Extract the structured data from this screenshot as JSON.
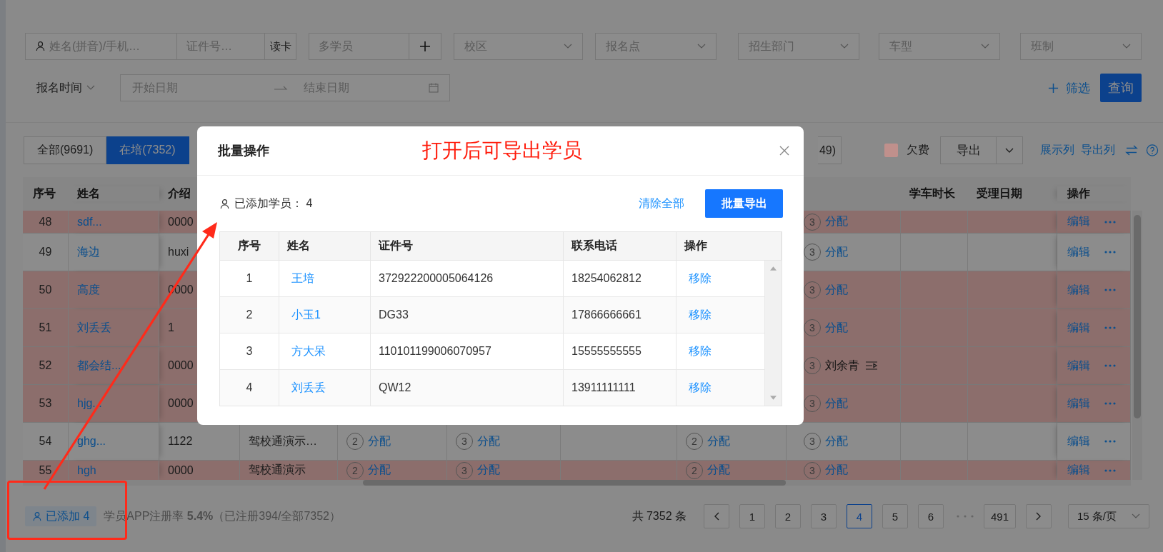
{
  "filters": {
    "name_field": {
      "placeholder": "姓名(拼音)/手机…"
    },
    "id_field": {
      "placeholder": "证件号…"
    },
    "read_card_button": "读卡",
    "multi_student_field": {
      "placeholder": "多学员"
    },
    "selects": [
      {
        "placeholder": "校区"
      },
      {
        "placeholder": "报名点"
      },
      {
        "placeholder": "招生部门"
      },
      {
        "placeholder": "车型"
      },
      {
        "placeholder": "班制"
      }
    ],
    "date_type": "报名时间",
    "date_range": {
      "start_placeholder": "开始日期",
      "end_placeholder": "结束日期"
    },
    "filter_link": "筛选",
    "query_button": "查询"
  },
  "status_tabs": [
    {
      "label": "全部(9691)",
      "selected": false
    },
    {
      "label": "在培(7352)",
      "selected": true
    },
    {
      "label": "49)",
      "selected": false
    }
  ],
  "toolbar": {
    "legend": {
      "label": "欠费",
      "color": "#c0908c"
    },
    "export_button": "导出",
    "links": [
      "展示列",
      "导出列"
    ]
  },
  "table": {
    "header": {
      "no": "序号",
      "name": "姓名",
      "intro": "介绍",
      "duration": "学车时长",
      "date": "受理日期",
      "actions": "操作"
    },
    "rows": [
      {
        "no": "48",
        "name": "sdf...",
        "intro": "0000",
        "arrears": true,
        "slots": {
          "s9": {
            "kind": "unassigned",
            "num": "3",
            "label": "分配"
          }
        },
        "edit": "编辑"
      },
      {
        "no": "49",
        "name": "海边",
        "intro": "huxi",
        "arrears": false,
        "slots": {
          "s9": {
            "kind": "unassigned",
            "num": "3",
            "label": "分配"
          }
        },
        "edit": "编辑"
      },
      {
        "no": "50",
        "name": "高度",
        "intro": "0000",
        "arrears": true,
        "slots": {
          "s9": {
            "kind": "unassigned",
            "num": "3",
            "label": "分配"
          }
        },
        "edit": "编辑"
      },
      {
        "no": "51",
        "name": "刘丢丢",
        "intro": "1",
        "arrears": true,
        "slots": {
          "s9": {
            "kind": "unassigned",
            "num": "3",
            "label": "分配"
          }
        },
        "edit": "编辑"
      },
      {
        "no": "52",
        "name": "都会结...",
        "intro": "0000",
        "arrears": true,
        "slots": {
          "s9": {
            "kind": "assigned",
            "num": "3",
            "label": "刘余青"
          }
        },
        "edit": "编辑"
      },
      {
        "no": "53",
        "name": "hjg...",
        "intro": "0000",
        "arrears": true,
        "slots": {
          "s9": {
            "kind": "unassigned",
            "num": "3",
            "label": "分配"
          }
        },
        "edit": "编辑"
      },
      {
        "no": "54",
        "name": "ghg...",
        "intro": "1122",
        "course": "驾校通演示…",
        "arrears": false,
        "slots": {
          "s5": {
            "kind": "unassigned",
            "num": "2",
            "label": "分配"
          },
          "s6": {
            "kind": "unassigned",
            "num": "3",
            "label": "分配"
          },
          "s8": {
            "kind": "unassigned",
            "num": "2",
            "label": "分配"
          },
          "s9": {
            "kind": "unassigned",
            "num": "3",
            "label": "分配"
          }
        },
        "edit": "编辑"
      },
      {
        "no": "55",
        "name": "hgh",
        "intro": "0000",
        "course": "驾校通演示",
        "arrears": true,
        "slots": {
          "s5": {
            "kind": "unassigned",
            "num": "2",
            "label": "分配"
          },
          "s6": {
            "kind": "unassigned",
            "num": "3",
            "label": "分配"
          },
          "s8": {
            "kind": "unassigned",
            "num": "2",
            "label": "分配"
          },
          "s9": {
            "kind": "unassigned",
            "num": "3",
            "label": "分配"
          }
        },
        "edit": "编辑"
      }
    ]
  },
  "footer": {
    "added_badge": "已添加 4",
    "registration": "学员APP注册率 **5.4%**（已注册394/全部7352）"
  },
  "pagination": {
    "total": "共 7352 条",
    "pages": [
      {
        "label": "1",
        "selected": false
      },
      {
        "label": "2",
        "selected": false
      },
      {
        "label": "3",
        "selected": false
      },
      {
        "label": "4",
        "selected": true
      },
      {
        "label": "5",
        "selected": false
      },
      {
        "label": "6",
        "selected": false
      }
    ],
    "last_page": "491",
    "page_size": "15 条/页"
  },
  "modal": {
    "title": "批量操作",
    "added_label": "已添加学员： 4",
    "clear_link": "清除全部",
    "export_button": "批量导出",
    "columns": [
      "序号",
      "姓名",
      "证件号",
      "联系电话",
      "操作"
    ],
    "rows": [
      {
        "no": "1",
        "name": "王培",
        "id": "372922200005064126",
        "phone": "18254062812",
        "action": "移除"
      },
      {
        "no": "2",
        "name": "小玉1",
        "id": "DG33",
        "phone": "17866666661",
        "action": "移除"
      },
      {
        "no": "3",
        "name": "方大呆",
        "id": "110101199006070957",
        "phone": "15555555555",
        "action": "移除"
      },
      {
        "no": "4",
        "name": "刘丢丢",
        "id": "QW12",
        "phone": "13911111111",
        "action": "移除"
      }
    ]
  },
  "annotation": {
    "callout": "打开后可导出学员"
  }
}
